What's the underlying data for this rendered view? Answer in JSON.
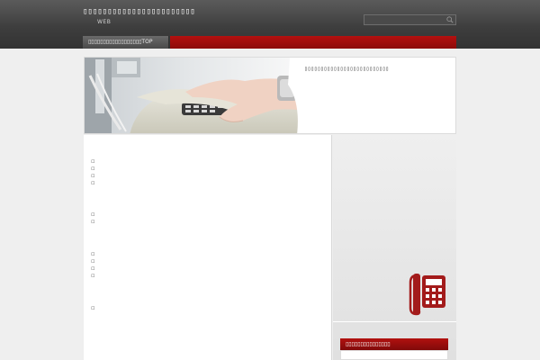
{
  "header": {
    "site_title": "▯▯▯▯▯▯▯▯▯▯▯▯▯▯▯▯▯▯▯▯▯▯▯",
    "site_subtitle": "WEB",
    "search": {
      "placeholder": "",
      "icon": "search-icon"
    }
  },
  "nav": {
    "home_label": "▯▯▯▯▯▯▯▯▯▯▯▯▯▯▯▯▯▯TOP"
  },
  "hero": {
    "caption": "▯▯▯▯▯▯▯▯▯▯▯▯▯▯▯▯▯▯▯▯▯▯▯▯▯▯"
  },
  "main": {
    "bullet_groups": [
      [
        "▫",
        "▫",
        "▫",
        "▫"
      ],
      [
        "▫",
        "▫"
      ],
      [
        "▫",
        "▫",
        "▫",
        "▫"
      ],
      [
        "▫"
      ]
    ]
  },
  "sidebar": {
    "phone_icon": "telephone-icon",
    "widget_title": "▯▯▯▯▯▯▯▯▯▯▯▯▯▯▯"
  },
  "colors": {
    "accent_red": "#a30e0d",
    "header_dark": "#3e3e3e"
  }
}
